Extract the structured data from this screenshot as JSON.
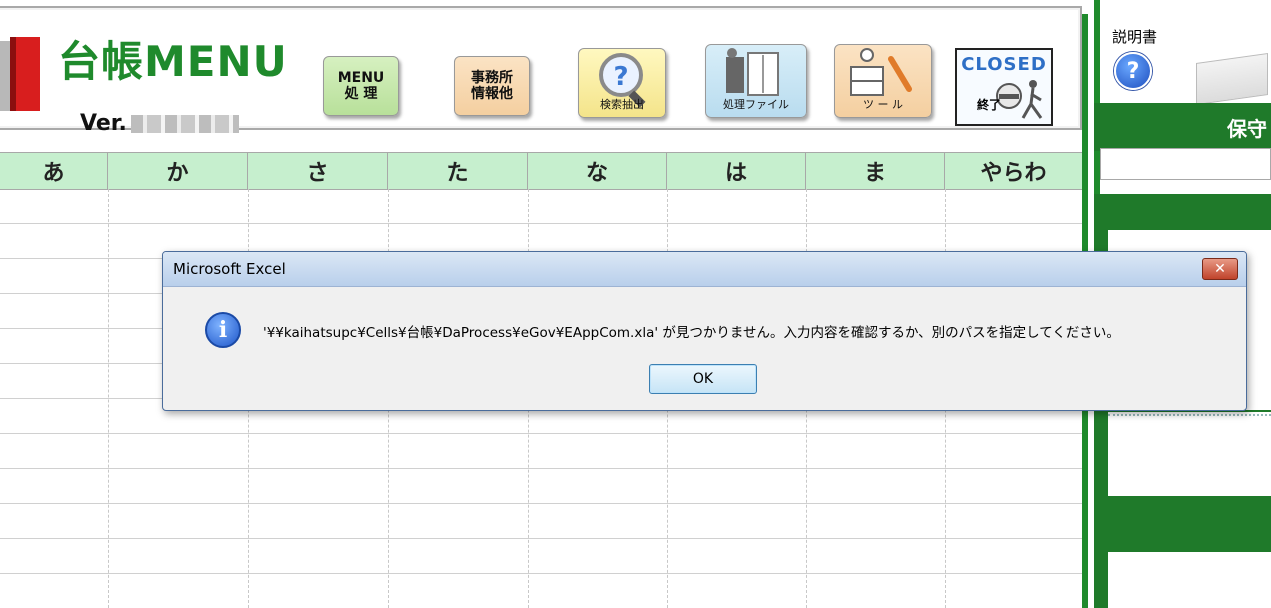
{
  "app": {
    "title_main": "台帳MENU",
    "version_label": "Ver."
  },
  "toolbar": {
    "menu_line1": "MENU",
    "menu_line2": "処 理",
    "office_line1": "事務所",
    "office_line2": "情報他",
    "search_label": "検索抽出",
    "process_file_label": "処理ファイル",
    "tool_label": "ツ ー ル",
    "closed_label": "CLOSED",
    "end_label": "終了"
  },
  "tabs": [
    "あ",
    "か",
    "さ",
    "た",
    "な",
    "は",
    "ま",
    "やらわ"
  ],
  "side": {
    "manual_label": "説明書",
    "help_glyph": "?",
    "band_title": "保守"
  },
  "dialog": {
    "title": "Microsoft Excel",
    "close_glyph": "✕",
    "info_glyph": "i",
    "message": "'¥¥kaihatsupc¥Cells¥台帳¥DaProcess¥eGov¥EAppCom.xla' が見つかりません。入力内容を確認するか、別のパスを指定してください。",
    "ok_label": "OK"
  }
}
